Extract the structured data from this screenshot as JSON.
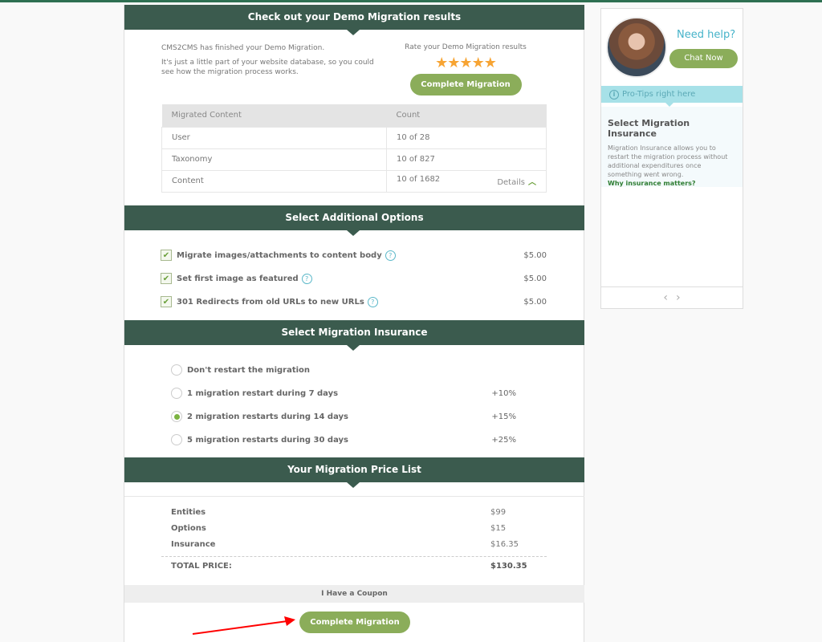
{
  "results": {
    "heading": "Check out your Demo Migration results",
    "intro_line1": "CMS2CMS has finished your Demo Migration.",
    "intro_line2": "It's just a little part of your website database, so you could see how the migration process works.",
    "rate_label": "Rate your Demo Migration results",
    "stars": "★★★★★",
    "rating": 5,
    "complete_button": "Complete Migration",
    "table": {
      "headers": [
        "Migrated Content",
        "Count"
      ],
      "rows": [
        {
          "type": "User",
          "count": "10 of 28"
        },
        {
          "type": "Taxonomy",
          "count": "10 of 827"
        },
        {
          "type": "Content",
          "count": "10 of 1682"
        }
      ],
      "details_link": "Details"
    }
  },
  "options": {
    "heading": "Select Additional Options",
    "items": [
      {
        "label": "Migrate images/attachments to content body",
        "price": "$5.00",
        "checked": true
      },
      {
        "label": "Set first image as featured",
        "price": "$5.00",
        "checked": true
      },
      {
        "label": "301 Redirects from old URLs to new URLs",
        "price": "$5.00",
        "checked": true
      }
    ],
    "help_glyph": "?"
  },
  "insurance": {
    "heading": "Select Migration Insurance",
    "items": [
      {
        "label": "Don't restart the migration",
        "pct": "",
        "selected": false
      },
      {
        "label": "1 migration restart during 7 days",
        "pct": "+10%",
        "selected": false
      },
      {
        "label": "2 migration restarts during 14 days",
        "pct": "+15%",
        "selected": true
      },
      {
        "label": "5 migration restarts during 30 days",
        "pct": "+25%",
        "selected": false
      }
    ]
  },
  "price_list": {
    "heading": "Your Migration Price List",
    "rows": [
      {
        "label": "Entities",
        "value": "$99"
      },
      {
        "label": "Options",
        "value": "$15"
      },
      {
        "label": "Insurance",
        "value": "$16.35"
      }
    ],
    "total_label": "TOTAL PRICE:",
    "total_value": "$130.35",
    "coupon": "I Have a Coupon",
    "complete_button": "Complete Migration"
  },
  "sidebar": {
    "need_help": "Need help?",
    "chat_button": "Chat Now",
    "pro_tips": "Pro-Tips right here",
    "tip_title": "Select Migration Insurance",
    "tip_text": "Migration Insurance allows you to restart the migration process without additional expenditures once something went wrong.",
    "tip_link": "Why insurance matters?",
    "prev": "‹",
    "next": "›"
  },
  "colors": {
    "header_green": "#3b5b4e",
    "button_green": "#8bad5a",
    "star_orange": "#f7a433",
    "tip_cyan": "#a7e1e8",
    "annotation_red": "#ff0000"
  }
}
